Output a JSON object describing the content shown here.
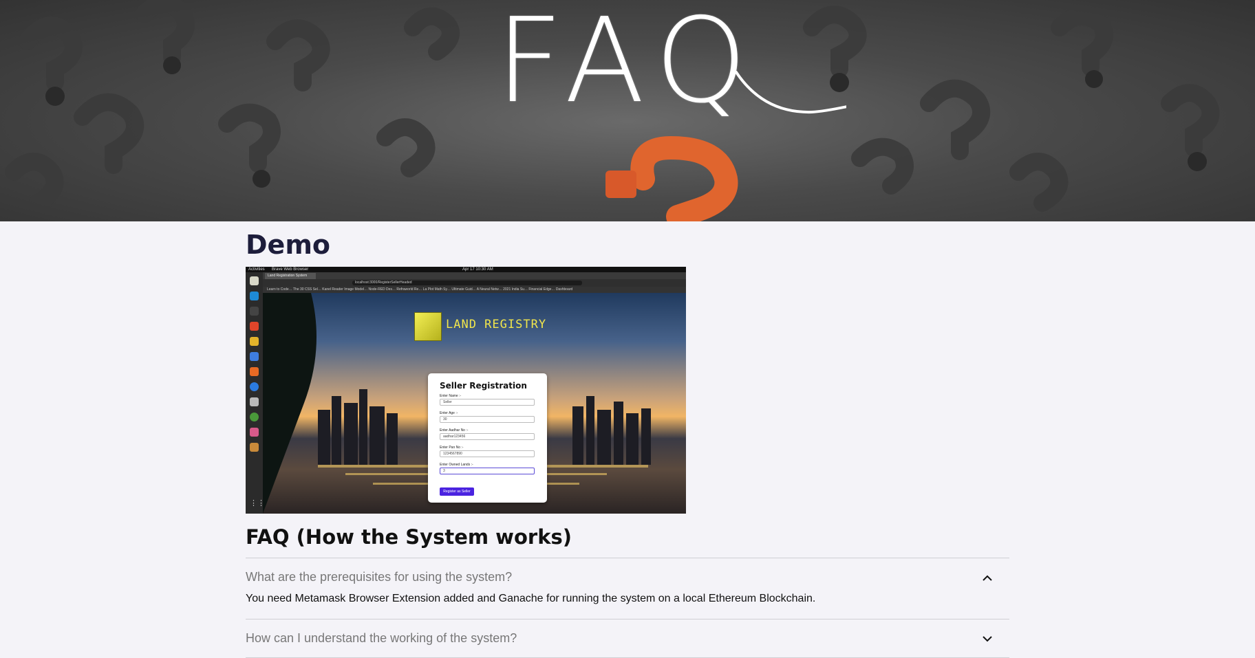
{
  "hero": {
    "title": "FAQ"
  },
  "demo": {
    "heading": "Demo",
    "screenshot": {
      "topbar_activities": "Activities",
      "topbar_app": "Brave Web Browser",
      "topbar_clock": "Apr 17 10:30 AM",
      "tab_label": "Land Registration System",
      "url": "localhost:3000/RegisterSellerHeaded",
      "bookmarks": "Learn to Code…   The 30 CSS Sel…   Kanel Reader   Image Model…   Node-RED Des…   Refraworld Re…   La Plot Math Sy…   Ultimate Guid…   A Neural Netw…   2021 India Su…   Financial Edge…   Dashboard",
      "logo_text": "LAND REGISTRY",
      "form": {
        "title": "Seller Registration",
        "fields": [
          {
            "label": "Enter Name :-",
            "value": "Seller"
          },
          {
            "label": "Enter Age :-",
            "value": "30"
          },
          {
            "label": "Enter Aadhar No :-",
            "value": "aadhar123456"
          },
          {
            "label": "Enter Pan No :-",
            "value": "1234567890"
          },
          {
            "label": "Enter Owned Lands :-",
            "value": "3"
          }
        ],
        "button": "Register as Seller"
      }
    }
  },
  "faq": {
    "heading": "FAQ (How the System works)",
    "items": [
      {
        "question": "What are the prerequisites for using the system?",
        "answer": "You need Metamask Browser Extension added and Ganache for running the system on a local Ethereum Blockchain.",
        "expanded": true,
        "icon": "chevron-up-icon"
      },
      {
        "question": "How can I understand the working of the system?",
        "answer": "",
        "expanded": false,
        "icon": "chevron-down-icon"
      }
    ]
  },
  "colors": {
    "heading": "#1d1d3b",
    "question_text": "#777777",
    "page_bg": "#f4f3f8",
    "accent_orange": "#e0652e"
  }
}
